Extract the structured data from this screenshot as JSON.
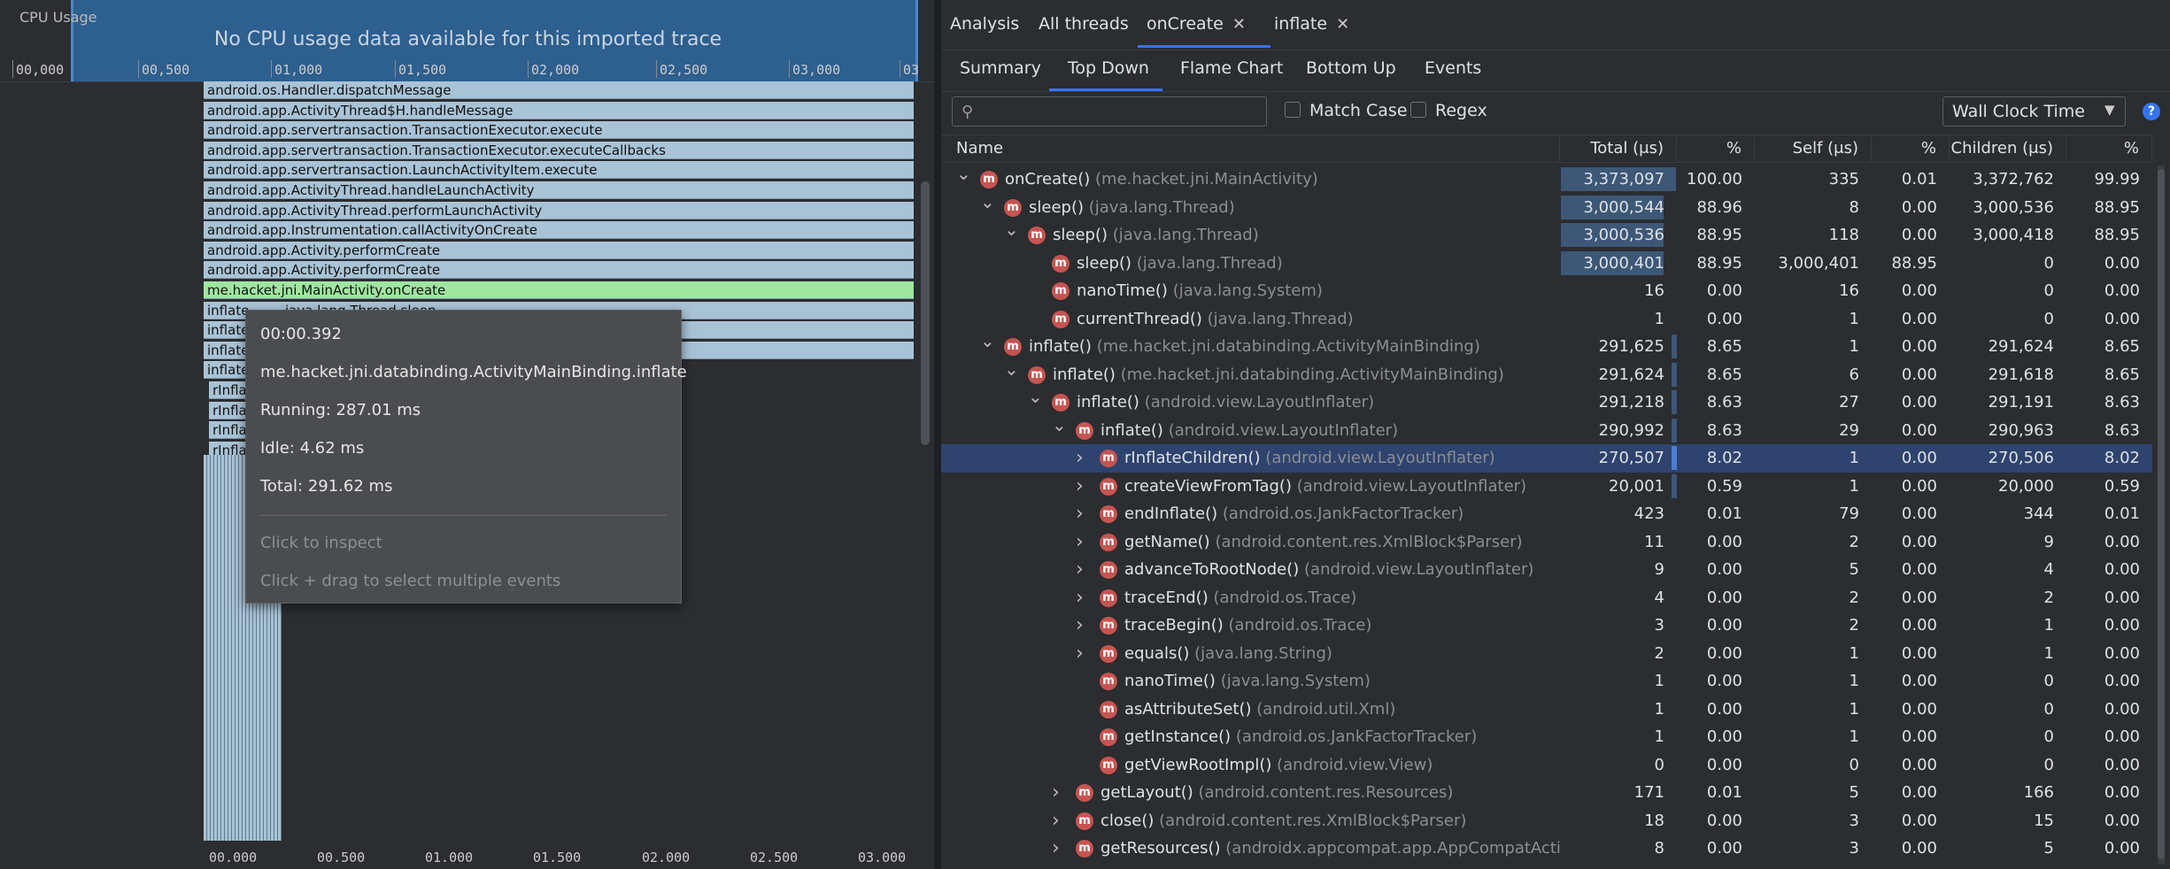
{
  "cpu": {
    "label": "CPU Usage",
    "message": "No CPU usage data available for this imported trace",
    "ticks": [
      "00,000",
      "00,500",
      "01,000",
      "01,500",
      "02,000",
      "02,500",
      "03,000",
      "03"
    ]
  },
  "flame": {
    "frames": [
      "android.os.Handler.dispatchMessage",
      "android.app.ActivityThread$H.handleMessage",
      "android.app.servertransaction.TransactionExecutor.execute",
      "android.app.servertransaction.TransactionExecutor.executeCallbacks",
      "android.app.servertransaction.LaunchActivityItem.execute",
      "android.app.ActivityThread.handleLaunchActivity",
      "android.app.ActivityThread.performLaunchActivity",
      "android.app.Instrumentation.callActivityOnCreate",
      "android.app.Activity.performCreate",
      "android.app.Activity.performCreate",
      "me.hacket.jni.MainActivity.onCreate"
    ],
    "short_inflate": "inflate",
    "short_rinflate": "rInfla",
    "sleep_frame": "java.lang.Thread.sleep",
    "bottom_ticks": [
      "00.000",
      "00.500",
      "01.000",
      "01.500",
      "02.000",
      "02.500",
      "03.000"
    ]
  },
  "tooltip": {
    "time": "00:00.392",
    "name": "me.hacket.jni.databinding.ActivityMainBinding.inflate",
    "running": "Running: 287.01 ms",
    "idle": "Idle: 4.62 ms",
    "total": "Total: 291.62 ms",
    "hint1": "Click to inspect",
    "hint2": "Click + drag to select multiple events"
  },
  "tabs": [
    {
      "label": "Analysis",
      "closable": false
    },
    {
      "label": "All threads",
      "closable": false
    },
    {
      "label": "onCreate",
      "closable": true
    },
    {
      "label": "inflate",
      "closable": true
    }
  ],
  "subtabs": [
    "Summary",
    "Top Down",
    "Flame Chart",
    "Bottom Up",
    "Events"
  ],
  "filter": {
    "placeholder": "",
    "match_case": "Match Case",
    "regex": "Regex",
    "clock": "Wall Clock Time",
    "help": "?"
  },
  "columns": [
    "Name",
    "Total (μs)",
    "%",
    "Self (μs)",
    "%",
    "Children (μs)",
    "%"
  ],
  "rows": [
    {
      "depth": 0,
      "exp": "open",
      "name": "onCreate()",
      "cls": "(me.hacket.jni.MainActivity)",
      "total": "3,373,097",
      "tp": "100.00",
      "self": "335",
      "sp": "0.01",
      "children": "3,372,762",
      "cp": "99.99",
      "bar": 1.0
    },
    {
      "depth": 1,
      "exp": "open",
      "name": "sleep()",
      "cls": "(java.lang.Thread)",
      "total": "3,000,544",
      "tp": "88.96",
      "self": "8",
      "sp": "0.00",
      "children": "3,000,536",
      "cp": "88.95",
      "bar": 0.8896
    },
    {
      "depth": 2,
      "exp": "open",
      "name": "sleep()",
      "cls": "(java.lang.Thread)",
      "total": "3,000,536",
      "tp": "88.95",
      "self": "118",
      "sp": "0.00",
      "children": "3,000,418",
      "cp": "88.95",
      "bar": 0.8895
    },
    {
      "depth": 3,
      "exp": "none",
      "name": "sleep()",
      "cls": "(java.lang.Thread)",
      "total": "3,000,401",
      "tp": "88.95",
      "self": "3,000,401",
      "sp": "88.95",
      "children": "0",
      "cp": "0.00",
      "bar": 0.8895
    },
    {
      "depth": 3,
      "exp": "none",
      "name": "nanoTime()",
      "cls": "(java.lang.System)",
      "total": "16",
      "tp": "0.00",
      "self": "16",
      "sp": "0.00",
      "children": "0",
      "cp": "0.00",
      "bar": 0
    },
    {
      "depth": 3,
      "exp": "none",
      "name": "currentThread()",
      "cls": "(java.lang.Thread)",
      "total": "1",
      "tp": "0.00",
      "self": "1",
      "sp": "0.00",
      "children": "0",
      "cp": "0.00",
      "bar": 0
    },
    {
      "depth": 1,
      "exp": "open",
      "name": "inflate()",
      "cls": "(me.hacket.jni.databinding.ActivityMainBinding)",
      "total": "291,625",
      "tp": "8.65",
      "self": "1",
      "sp": "0.00",
      "children": "291,624",
      "cp": "8.65",
      "bar": 0.0865
    },
    {
      "depth": 2,
      "exp": "open",
      "name": "inflate()",
      "cls": "(me.hacket.jni.databinding.ActivityMainBinding)",
      "total": "291,624",
      "tp": "8.65",
      "self": "6",
      "sp": "0.00",
      "children": "291,618",
      "cp": "8.65",
      "bar": 0.0865
    },
    {
      "depth": 3,
      "exp": "open",
      "name": "inflate()",
      "cls": "(android.view.LayoutInflater)",
      "total": "291,218",
      "tp": "8.63",
      "self": "27",
      "sp": "0.00",
      "children": "291,191",
      "cp": "8.63",
      "bar": 0.0863
    },
    {
      "depth": 4,
      "exp": "open",
      "name": "inflate()",
      "cls": "(android.view.LayoutInflater)",
      "total": "290,992",
      "tp": "8.63",
      "self": "29",
      "sp": "0.00",
      "children": "290,963",
      "cp": "8.63",
      "bar": 0.0863
    },
    {
      "depth": 5,
      "exp": "closed",
      "name": "rInflateChildren()",
      "cls": "(android.view.LayoutInflater)",
      "total": "270,507",
      "tp": "8.02",
      "self": "1",
      "sp": "0.00",
      "children": "270,506",
      "cp": "8.02",
      "bar": 0.0802,
      "selected": true
    },
    {
      "depth": 5,
      "exp": "closed",
      "name": "createViewFromTag()",
      "cls": "(android.view.LayoutInflater)",
      "total": "20,001",
      "tp": "0.59",
      "self": "1",
      "sp": "0.00",
      "children": "20,000",
      "cp": "0.59",
      "bar": 0.0059
    },
    {
      "depth": 5,
      "exp": "closed",
      "name": "endInflate()",
      "cls": "(android.os.JankFactorTracker)",
      "total": "423",
      "tp": "0.01",
      "self": "79",
      "sp": "0.00",
      "children": "344",
      "cp": "0.01",
      "bar": 0
    },
    {
      "depth": 5,
      "exp": "closed",
      "name": "getName()",
      "cls": "(android.content.res.XmlBlock$Parser)",
      "total": "11",
      "tp": "0.00",
      "self": "2",
      "sp": "0.00",
      "children": "9",
      "cp": "0.00",
      "bar": 0
    },
    {
      "depth": 5,
      "exp": "closed",
      "name": "advanceToRootNode()",
      "cls": "(android.view.LayoutInflater)",
      "total": "9",
      "tp": "0.00",
      "self": "5",
      "sp": "0.00",
      "children": "4",
      "cp": "0.00",
      "bar": 0
    },
    {
      "depth": 5,
      "exp": "closed",
      "name": "traceEnd()",
      "cls": "(android.os.Trace)",
      "total": "4",
      "tp": "0.00",
      "self": "2",
      "sp": "0.00",
      "children": "2",
      "cp": "0.00",
      "bar": 0
    },
    {
      "depth": 5,
      "exp": "closed",
      "name": "traceBegin()",
      "cls": "(android.os.Trace)",
      "total": "3",
      "tp": "0.00",
      "self": "2",
      "sp": "0.00",
      "children": "1",
      "cp": "0.00",
      "bar": 0
    },
    {
      "depth": 5,
      "exp": "closed",
      "name": "equals()",
      "cls": "(java.lang.String)",
      "total": "2",
      "tp": "0.00",
      "self": "1",
      "sp": "0.00",
      "children": "1",
      "cp": "0.00",
      "bar": 0
    },
    {
      "depth": 5,
      "exp": "none",
      "name": "nanoTime()",
      "cls": "(java.lang.System)",
      "total": "1",
      "tp": "0.00",
      "self": "1",
      "sp": "0.00",
      "children": "0",
      "cp": "0.00",
      "bar": 0
    },
    {
      "depth": 5,
      "exp": "none",
      "name": "asAttributeSet()",
      "cls": "(android.util.Xml)",
      "total": "1",
      "tp": "0.00",
      "self": "1",
      "sp": "0.00",
      "children": "0",
      "cp": "0.00",
      "bar": 0
    },
    {
      "depth": 5,
      "exp": "none",
      "name": "getInstance()",
      "cls": "(android.os.JankFactorTracker)",
      "total": "1",
      "tp": "0.00",
      "self": "1",
      "sp": "0.00",
      "children": "0",
      "cp": "0.00",
      "bar": 0
    },
    {
      "depth": 5,
      "exp": "none",
      "name": "getViewRootImpl()",
      "cls": "(android.view.View)",
      "total": "0",
      "tp": "0.00",
      "self": "0",
      "sp": "0.00",
      "children": "0",
      "cp": "0.00",
      "bar": 0
    },
    {
      "depth": 4,
      "exp": "closed",
      "name": "getLayout()",
      "cls": "(android.content.res.Resources)",
      "total": "171",
      "tp": "0.01",
      "self": "5",
      "sp": "0.00",
      "children": "166",
      "cp": "0.00",
      "bar": 0
    },
    {
      "depth": 4,
      "exp": "closed",
      "name": "close()",
      "cls": "(android.content.res.XmlBlock$Parser)",
      "total": "18",
      "tp": "0.00",
      "self": "3",
      "sp": "0.00",
      "children": "15",
      "cp": "0.00",
      "bar": 0
    },
    {
      "depth": 4,
      "exp": "closed",
      "name": "getResources()",
      "cls": "(androidx.appcompat.app.AppCompatActivi",
      "total": "8",
      "tp": "0.00",
      "self": "3",
      "sp": "0.00",
      "children": "5",
      "cp": "0.00",
      "bar": 0
    }
  ]
}
